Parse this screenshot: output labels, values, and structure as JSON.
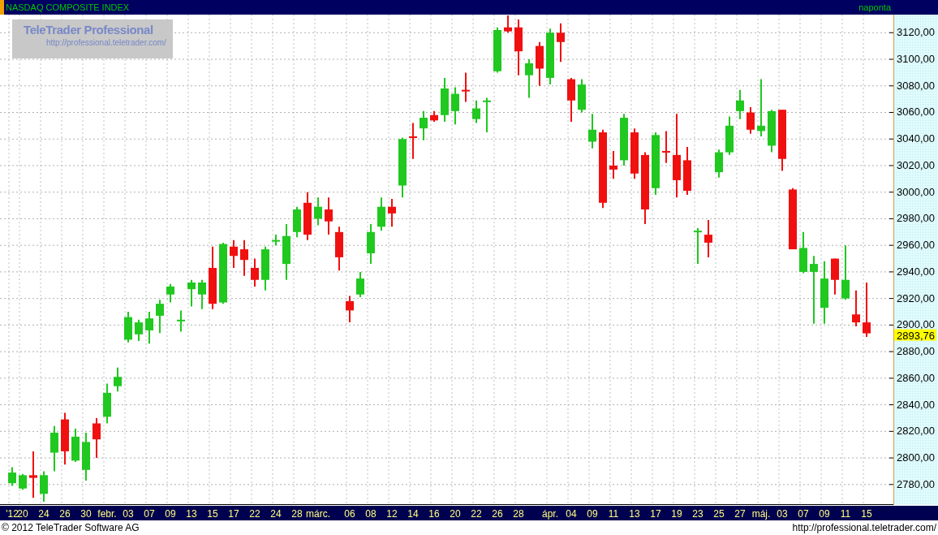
{
  "header": {
    "title": "NASDAQ COMPOSITE INDEX",
    "period": "naponta"
  },
  "logo": {
    "name": "TeleTrader Professional",
    "url": "http://professional.teletrader.com/"
  },
  "chart_data": {
    "type": "candlestick",
    "ylim": [
      2764,
      3133
    ],
    "grid": true,
    "yticks": [
      {
        "value": 3120,
        "label": "3120,00"
      },
      {
        "value": 3100,
        "label": "3100,00"
      },
      {
        "value": 3080,
        "label": "3080,00"
      },
      {
        "value": 3060,
        "label": "3060,00"
      },
      {
        "value": 3040,
        "label": "3040,00"
      },
      {
        "value": 3020,
        "label": "3020,00"
      },
      {
        "value": 3000,
        "label": "3000,00"
      },
      {
        "value": 2980,
        "label": "2980,00"
      },
      {
        "value": 2960,
        "label": "2960,00"
      },
      {
        "value": 2940,
        "label": "2940,00"
      },
      {
        "value": 2920,
        "label": "2920,00"
      },
      {
        "value": 2900,
        "label": "2900,00"
      },
      {
        "value": 2880,
        "label": "2880,00"
      },
      {
        "value": 2860,
        "label": "2860,00"
      },
      {
        "value": 2840,
        "label": "2840,00"
      },
      {
        "value": 2820,
        "label": "2820,00"
      },
      {
        "value": 2800,
        "label": "2800,00"
      },
      {
        "value": 2780,
        "label": "2780,00"
      }
    ],
    "categories": [
      "'12",
      "20",
      null,
      "24",
      null,
      "26",
      null,
      "30",
      null,
      "febr.",
      null,
      "03",
      null,
      "07",
      null,
      "09",
      null,
      "13",
      null,
      "15",
      null,
      "17",
      null,
      "22",
      null,
      "24",
      null,
      "28",
      null,
      "márc.",
      null,
      null,
      "06",
      null,
      "08",
      null,
      "12",
      null,
      "14",
      null,
      "16",
      null,
      "20",
      null,
      "22",
      null,
      "26",
      null,
      "28",
      null,
      null,
      "ápr.",
      null,
      "04",
      null,
      "09",
      null,
      "11",
      null,
      "13",
      null,
      "17",
      null,
      "19",
      null,
      "23",
      null,
      "25",
      null,
      "27",
      null,
      "máj.",
      null,
      "03",
      null,
      "07",
      null,
      "09",
      null,
      "11",
      null,
      "15"
    ],
    "ohlc": [
      [
        2781,
        2793,
        2779,
        2789
      ],
      [
        2777,
        2788,
        2776,
        2787
      ],
      [
        2787,
        2805,
        2770,
        2785
      ],
      [
        2773,
        2790,
        2767,
        2787
      ],
      [
        2804,
        2824,
        2790,
        2819
      ],
      [
        2829,
        2834,
        2795,
        2805
      ],
      [
        2798,
        2822,
        2797,
        2816
      ],
      [
        2791,
        2819,
        2783,
        2812
      ],
      [
        2826,
        2830,
        2800,
        2814
      ],
      [
        2831,
        2856,
        2826,
        2849
      ],
      [
        2854,
        2868,
        2850,
        2861
      ],
      [
        2889,
        2910,
        2887,
        2906
      ],
      [
        2893,
        2904,
        2888,
        2902
      ],
      [
        2896,
        2910,
        2886,
        2905
      ],
      [
        2907,
        2919,
        2894,
        2916
      ],
      [
        2923,
        2931,
        2917,
        2929
      ],
      [
        2903,
        2911,
        2895,
        2904
      ],
      [
        2927,
        2934,
        2914,
        2932
      ],
      [
        2923,
        2934,
        2912,
        2932
      ],
      [
        2943,
        2959,
        2912,
        2916
      ],
      [
        2917,
        2962,
        2916,
        2961
      ],
      [
        2959,
        2964,
        2943,
        2952
      ],
      [
        2957,
        2964,
        2937,
        2949
      ],
      [
        2943,
        2950,
        2929,
        2934
      ],
      [
        2934,
        2959,
        2926,
        2957
      ],
      [
        2963,
        2968,
        2960,
        2964
      ],
      [
        2946,
        2976,
        2934,
        2967
      ],
      [
        2970,
        2989,
        2966,
        2987
      ],
      [
        2992,
        3000,
        2964,
        2968
      ],
      [
        2980,
        2996,
        2975,
        2989
      ],
      [
        2987,
        2996,
        2968,
        2978
      ],
      [
        2970,
        2974,
        2941,
        2951
      ],
      [
        2918,
        2922,
        2902,
        2911
      ],
      [
        2923,
        2940,
        2921,
        2935
      ],
      [
        2954,
        2976,
        2946,
        2970
      ],
      [
        2974,
        2996,
        2971,
        2989
      ],
      [
        2989,
        2995,
        2974,
        2984
      ],
      [
        3005,
        3041,
        2996,
        3040
      ],
      [
        3042,
        3052,
        3025,
        3041
      ],
      [
        3048,
        3061,
        3039,
        3056
      ],
      [
        3058,
        3061,
        3053,
        3054
      ],
      [
        3058,
        3086,
        3053,
        3078
      ],
      [
        3061,
        3079,
        3051,
        3074
      ],
      [
        3077,
        3090,
        3068,
        3076
      ],
      [
        3055,
        3069,
        3052,
        3063
      ],
      [
        3068,
        3071,
        3045,
        3069
      ],
      [
        3091,
        3124,
        3090,
        3122
      ],
      [
        3124,
        3133,
        3120,
        3121
      ],
      [
        3124,
        3130,
        3088,
        3106
      ],
      [
        3088,
        3100,
        3071,
        3097
      ],
      [
        3110,
        3113,
        3080,
        3093
      ],
      [
        3086,
        3123,
        3081,
        3120
      ],
      [
        3120,
        3127,
        3098,
        3113
      ],
      [
        3085,
        3086,
        3053,
        3069
      ],
      [
        3062,
        3085,
        3060,
        3081
      ],
      [
        3038,
        3059,
        3033,
        3047
      ],
      [
        3045,
        3047,
        2988,
        2992
      ],
      [
        3020,
        3031,
        3010,
        3017
      ],
      [
        3024,
        3059,
        3020,
        3056
      ],
      [
        3045,
        3048,
        3010,
        3014
      ],
      [
        3028,
        3030,
        2976,
        2987
      ],
      [
        3003,
        3045,
        2998,
        3043
      ],
      [
        3031,
        3046,
        3022,
        3030
      ],
      [
        3028,
        3059,
        2996,
        3009
      ],
      [
        3024,
        3034,
        2998,
        3001
      ],
      [
        2970,
        2973,
        2946,
        2971
      ],
      [
        2968,
        2979,
        2951,
        2962
      ],
      [
        3015,
        3032,
        3011,
        3030
      ],
      [
        3030,
        3057,
        3028,
        3050
      ],
      [
        3061,
        3077,
        3055,
        3069
      ],
      [
        3060,
        3064,
        3044,
        3047
      ],
      [
        3046,
        3085,
        3042,
        3050
      ],
      [
        3035,
        3062,
        3030,
        3061
      ],
      [
        3062,
        3062,
        3016,
        3025
      ],
      [
        3002,
        3003,
        2957,
        2957
      ],
      [
        2940,
        2970,
        2939,
        2958
      ],
      [
        2940,
        2952,
        2901,
        2946
      ],
      [
        2913,
        2948,
        2901,
        2935
      ],
      [
        2950,
        2950,
        2923,
        2934
      ],
      [
        2920,
        2960,
        2919,
        2934
      ],
      [
        2908,
        2926,
        2899,
        2902
      ],
      [
        2902,
        2932,
        2891,
        2893.76
      ]
    ],
    "annotations": [
      "2893,76"
    ]
  },
  "footer": {
    "copyright": "© 2012 TeleTrader Software AG",
    "url": "http://professional.teletrader.com/"
  }
}
